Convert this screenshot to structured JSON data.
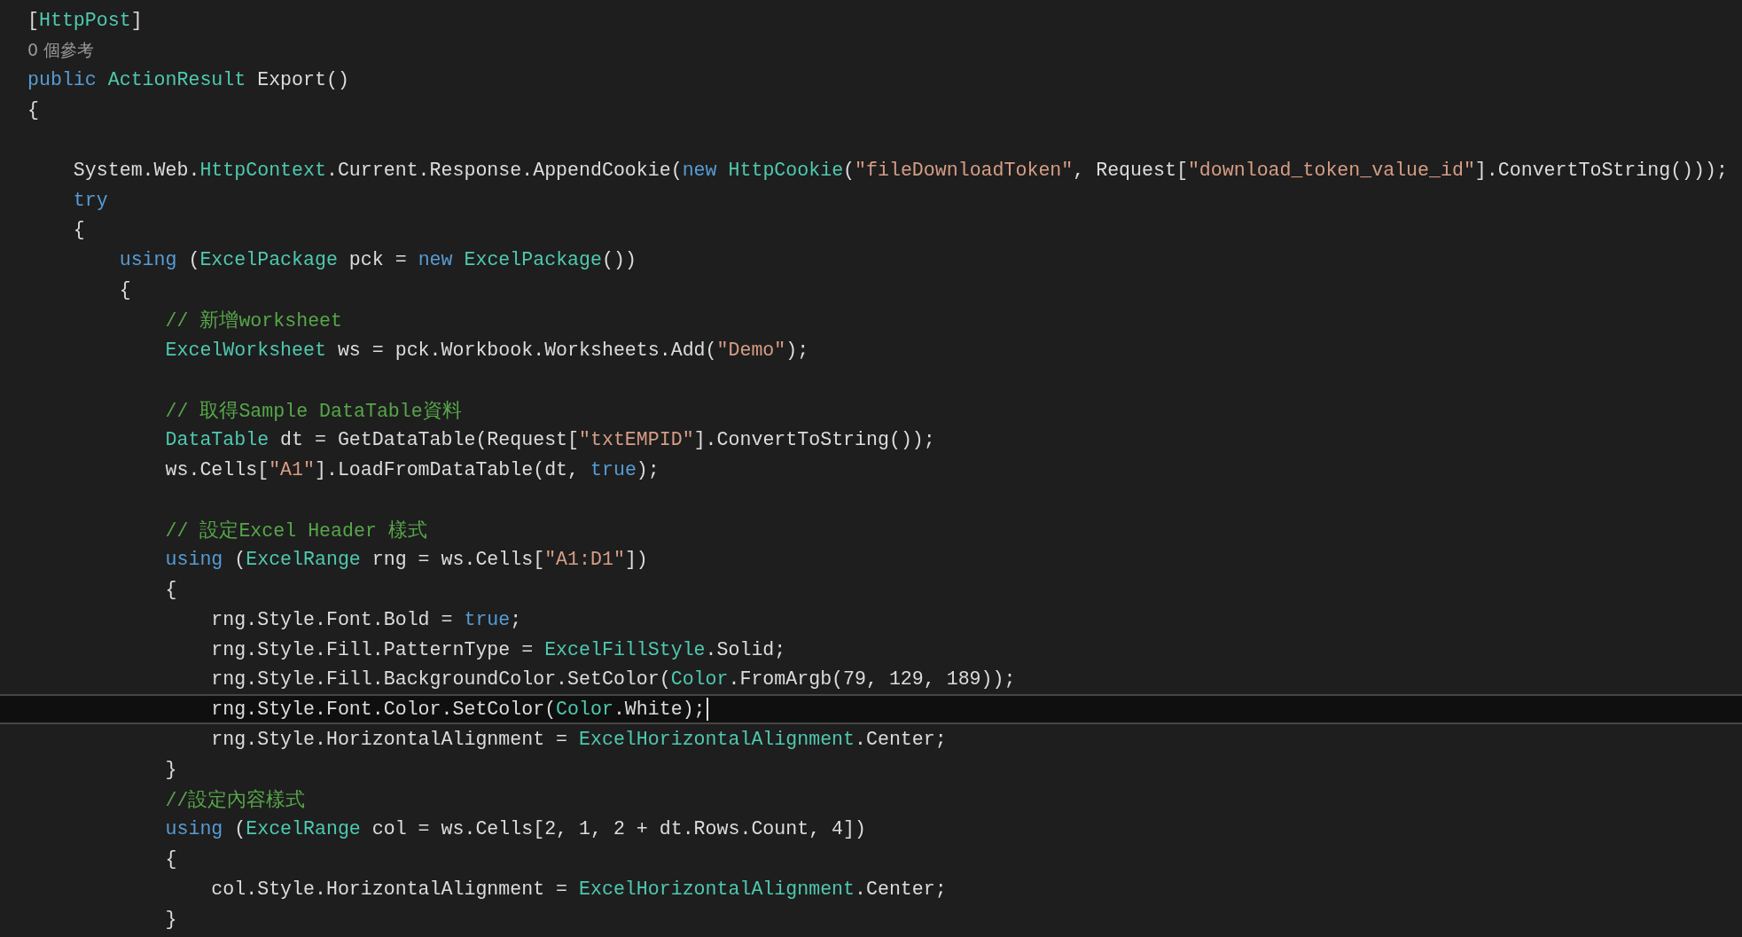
{
  "editor": {
    "lines": [
      {
        "kind": "code",
        "current": false,
        "tokens": [
          {
            "text": "[",
            "kind": "plain"
          },
          {
            "text": "HttpPost",
            "kind": "type"
          },
          {
            "text": "]",
            "kind": "plain"
          }
        ]
      },
      {
        "kind": "codelens",
        "current": false,
        "text": "0 個參考"
      },
      {
        "kind": "code",
        "current": false,
        "tokens": [
          {
            "text": "public ",
            "kind": "keyword"
          },
          {
            "text": "ActionResult",
            "kind": "type"
          },
          {
            "text": " Export()",
            "kind": "plain"
          }
        ]
      },
      {
        "kind": "code",
        "current": false,
        "tokens": [
          {
            "text": "{",
            "kind": "plain"
          }
        ]
      },
      {
        "kind": "blank",
        "current": false
      },
      {
        "kind": "code",
        "current": false,
        "tokens": [
          {
            "text": "    System.Web.",
            "kind": "plain"
          },
          {
            "text": "HttpContext",
            "kind": "type"
          },
          {
            "text": ".Current.Response.AppendCookie(",
            "kind": "plain"
          },
          {
            "text": "new ",
            "kind": "keyword"
          },
          {
            "text": "HttpCookie",
            "kind": "type"
          },
          {
            "text": "(",
            "kind": "plain"
          },
          {
            "text": "\"fileDownloadToken\"",
            "kind": "string"
          },
          {
            "text": ", Request[",
            "kind": "plain"
          },
          {
            "text": "\"download_token_value_id\"",
            "kind": "string"
          },
          {
            "text": "].ConvertToString()));",
            "kind": "plain"
          }
        ]
      },
      {
        "kind": "code",
        "current": false,
        "tokens": [
          {
            "text": "    try",
            "kind": "keyword"
          }
        ]
      },
      {
        "kind": "code",
        "current": false,
        "tokens": [
          {
            "text": "    {",
            "kind": "plain"
          }
        ]
      },
      {
        "kind": "code",
        "current": false,
        "tokens": [
          {
            "text": "        using",
            "kind": "keyword"
          },
          {
            "text": " (",
            "kind": "plain"
          },
          {
            "text": "ExcelPackage",
            "kind": "type"
          },
          {
            "text": " pck = ",
            "kind": "plain"
          },
          {
            "text": "new ",
            "kind": "keyword"
          },
          {
            "text": "ExcelPackage",
            "kind": "type"
          },
          {
            "text": "())",
            "kind": "plain"
          }
        ]
      },
      {
        "kind": "code",
        "current": false,
        "tokens": [
          {
            "text": "        {",
            "kind": "plain"
          }
        ]
      },
      {
        "kind": "code",
        "current": false,
        "tokens": [
          {
            "text": "            // 新增worksheet",
            "kind": "comment"
          }
        ]
      },
      {
        "kind": "code",
        "current": false,
        "tokens": [
          {
            "text": "            ExcelWorksheet",
            "kind": "type"
          },
          {
            "text": " ws = pck.Workbook.Worksheets.Add(",
            "kind": "plain"
          },
          {
            "text": "\"Demo\"",
            "kind": "string"
          },
          {
            "text": ");",
            "kind": "plain"
          }
        ]
      },
      {
        "kind": "blank",
        "current": false
      },
      {
        "kind": "code",
        "current": false,
        "tokens": [
          {
            "text": "            // 取得Sample DataTable資料",
            "kind": "comment"
          }
        ]
      },
      {
        "kind": "code",
        "current": false,
        "tokens": [
          {
            "text": "            DataTable",
            "kind": "type"
          },
          {
            "text": " dt = GetDataTable(Request[",
            "kind": "plain"
          },
          {
            "text": "\"txtEMPID\"",
            "kind": "string"
          },
          {
            "text": "].ConvertToString());",
            "kind": "plain"
          }
        ]
      },
      {
        "kind": "code",
        "current": false,
        "tokens": [
          {
            "text": "            ws.Cells[",
            "kind": "plain"
          },
          {
            "text": "\"A1\"",
            "kind": "string"
          },
          {
            "text": "].LoadFromDataTable(dt, ",
            "kind": "plain"
          },
          {
            "text": "true",
            "kind": "keyword"
          },
          {
            "text": ");",
            "kind": "plain"
          }
        ]
      },
      {
        "kind": "blank",
        "current": false
      },
      {
        "kind": "code",
        "current": false,
        "tokens": [
          {
            "text": "            // 設定Excel Header 樣式",
            "kind": "comment"
          }
        ]
      },
      {
        "kind": "code",
        "current": false,
        "tokens": [
          {
            "text": "            using",
            "kind": "keyword"
          },
          {
            "text": " (",
            "kind": "plain"
          },
          {
            "text": "ExcelRange",
            "kind": "type"
          },
          {
            "text": " rng = ws.Cells[",
            "kind": "plain"
          },
          {
            "text": "\"A1:D1\"",
            "kind": "string"
          },
          {
            "text": "])",
            "kind": "plain"
          }
        ]
      },
      {
        "kind": "code",
        "current": false,
        "tokens": [
          {
            "text": "            {",
            "kind": "plain"
          }
        ]
      },
      {
        "kind": "code",
        "current": false,
        "tokens": [
          {
            "text": "                rng.Style.Font.Bold = ",
            "kind": "plain"
          },
          {
            "text": "true",
            "kind": "keyword"
          },
          {
            "text": ";",
            "kind": "plain"
          }
        ]
      },
      {
        "kind": "code",
        "current": false,
        "tokens": [
          {
            "text": "                rng.Style.Fill.PatternType = ",
            "kind": "plain"
          },
          {
            "text": "ExcelFillStyle",
            "kind": "type"
          },
          {
            "text": ".Solid;",
            "kind": "plain"
          }
        ]
      },
      {
        "kind": "code",
        "current": false,
        "tokens": [
          {
            "text": "                rng.Style.Fill.BackgroundColor.SetColor(",
            "kind": "plain"
          },
          {
            "text": "Color",
            "kind": "type"
          },
          {
            "text": ".FromArgb(79, 129, 189));",
            "kind": "plain"
          }
        ]
      },
      {
        "kind": "code",
        "current": true,
        "tokens": [
          {
            "text": "                rng.Style.Font.Color.SetColor(",
            "kind": "plain"
          },
          {
            "text": "Color",
            "kind": "type"
          },
          {
            "text": ".White);",
            "kind": "plain"
          }
        ]
      },
      {
        "kind": "code",
        "current": false,
        "tokens": [
          {
            "text": "                rng.Style.HorizontalAlignment = ",
            "kind": "plain"
          },
          {
            "text": "ExcelHorizontalAlignment",
            "kind": "type"
          },
          {
            "text": ".Center;",
            "kind": "plain"
          }
        ]
      },
      {
        "kind": "code",
        "current": false,
        "tokens": [
          {
            "text": "            }",
            "kind": "plain"
          }
        ]
      },
      {
        "kind": "code",
        "current": false,
        "tokens": [
          {
            "text": "            //設定內容樣式",
            "kind": "comment"
          }
        ]
      },
      {
        "kind": "code",
        "current": false,
        "tokens": [
          {
            "text": "            using",
            "kind": "keyword"
          },
          {
            "text": " (",
            "kind": "plain"
          },
          {
            "text": "ExcelRange",
            "kind": "type"
          },
          {
            "text": " col = ws.Cells[2, 1, 2 + dt.Rows.Count, 4])",
            "kind": "plain"
          }
        ]
      },
      {
        "kind": "code",
        "current": false,
        "tokens": [
          {
            "text": "            {",
            "kind": "plain"
          }
        ]
      },
      {
        "kind": "code",
        "current": false,
        "tokens": [
          {
            "text": "                col.Style.HorizontalAlignment = ",
            "kind": "plain"
          },
          {
            "text": "ExcelHorizontalAlignment",
            "kind": "type"
          },
          {
            "text": ".Center;",
            "kind": "plain"
          }
        ]
      },
      {
        "kind": "code",
        "current": false,
        "tokens": [
          {
            "text": "            }",
            "kind": "plain"
          }
        ]
      }
    ]
  }
}
